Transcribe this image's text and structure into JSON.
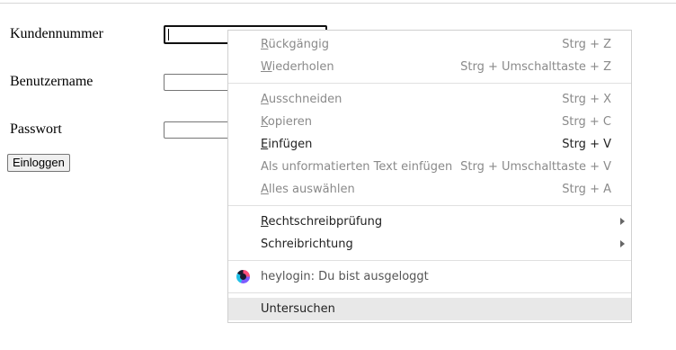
{
  "form": {
    "customer_number_label": "Kundennummer",
    "username_label": "Benutzername",
    "password_label": "Passwort",
    "customer_number_value": "",
    "username_value": "",
    "password_value": "",
    "login_button": "Einloggen"
  },
  "context_menu": {
    "undo": {
      "first": "R",
      "rest": "ückgängig",
      "shortcut": "Strg + Z"
    },
    "redo": {
      "first": "W",
      "rest": "iederholen",
      "shortcut": "Strg + Umschalttaste + Z"
    },
    "cut": {
      "first": "A",
      "rest": "usschneiden",
      "shortcut": "Strg + X"
    },
    "copy": {
      "first": "K",
      "rest": "opieren",
      "shortcut": "Strg + C"
    },
    "paste": {
      "first": "E",
      "rest": "infügen",
      "shortcut": "Strg + V"
    },
    "paste_plain": {
      "label": "Als unformatierten Text einfügen",
      "shortcut": "Strg + Umschalttaste + V"
    },
    "select_all": {
      "first": "A",
      "rest": "lles auswählen",
      "shortcut": "Strg + A"
    },
    "spellcheck": {
      "first": "R",
      "rest": "echtschreibprüfung"
    },
    "writing_direction": {
      "label": "Schreibrichtung"
    },
    "heylogin": {
      "label": "heylogin: Du bist ausgeloggt",
      "icon": "heylogin-icon"
    },
    "inspect": {
      "label": "Untersuchen"
    }
  }
}
